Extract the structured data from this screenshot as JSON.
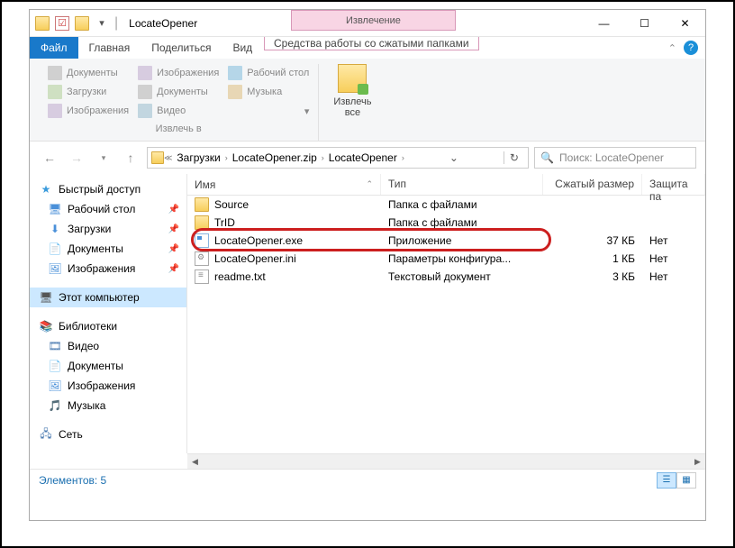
{
  "titlebar": {
    "title": "LocateOpener",
    "context_label": "Извлечение"
  },
  "tabs": {
    "file": "Файл",
    "home": "Главная",
    "share": "Поделиться",
    "view": "Вид",
    "context": "Средства работы со сжатыми папками"
  },
  "ribbon": {
    "items": [
      [
        "Документы",
        "Изображения",
        "Рабочий стол"
      ],
      [
        "Загрузки",
        "Документы",
        "Музыка"
      ],
      [
        "Изображения",
        "Видео",
        ""
      ]
    ],
    "group_label": "Извлечь в",
    "extract_all": "Извлечь\nвсе"
  },
  "address": {
    "segments": [
      "Загрузки",
      "LocateOpener.zip",
      "LocateOpener"
    ]
  },
  "search": {
    "placeholder": "Поиск: LocateOpener"
  },
  "sidebar": {
    "quick": "Быстрый доступ",
    "quick_items": [
      "Рабочий стол",
      "Загрузки",
      "Документы",
      "Изображения"
    ],
    "this_pc": "Этот компьютер",
    "libraries": "Библиотеки",
    "lib_items": [
      "Видео",
      "Документы",
      "Изображения",
      "Музыка"
    ],
    "network": "Сеть"
  },
  "columns": {
    "name": "Имя",
    "type": "Тип",
    "size": "Сжатый размер",
    "prot": "Защита па"
  },
  "rows": [
    {
      "name": "Source",
      "type": "Папка с файлами",
      "size": "",
      "prot": "",
      "icon": "folder"
    },
    {
      "name": "TrID",
      "type": "Папка с файлами",
      "size": "",
      "prot": "",
      "icon": "folder"
    },
    {
      "name": "LocateOpener.exe",
      "type": "Приложение",
      "size": "37 КБ",
      "prot": "Нет",
      "icon": "exe"
    },
    {
      "name": "LocateOpener.ini",
      "type": "Параметры конфигура...",
      "size": "1 КБ",
      "prot": "Нет",
      "icon": "ini"
    },
    {
      "name": "readme.txt",
      "type": "Текстовый документ",
      "size": "3 КБ",
      "prot": "Нет",
      "icon": "txt"
    }
  ],
  "status": {
    "count_label": "Элементов: 5"
  }
}
